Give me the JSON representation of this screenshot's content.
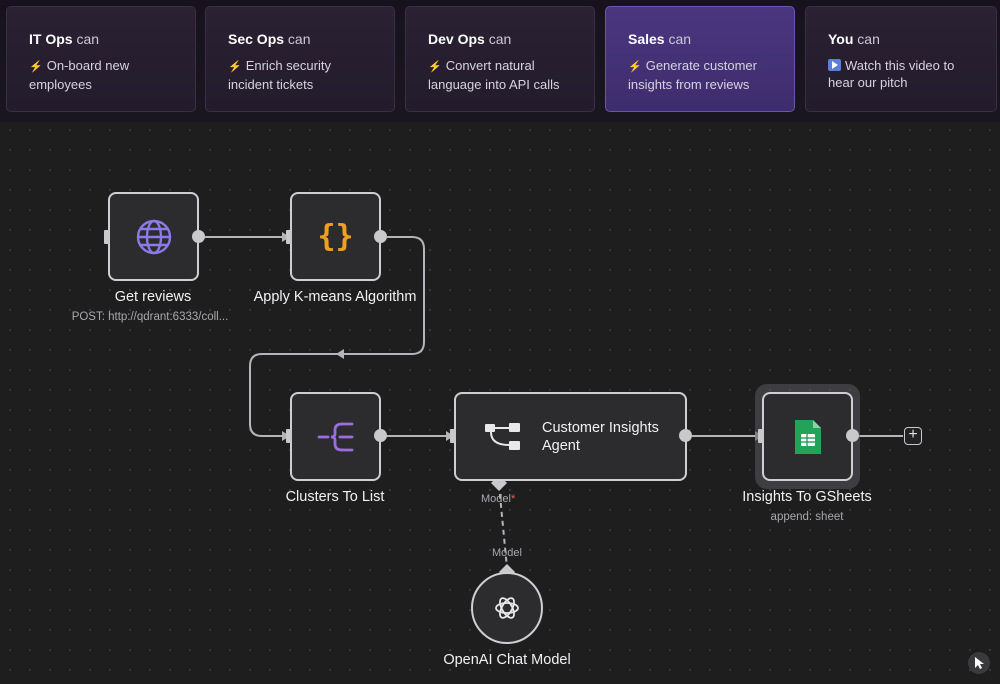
{
  "personas": [
    {
      "team": "IT Ops",
      "can": "can",
      "icon": "bolt-icon",
      "desc": "On-board new employees",
      "active": false
    },
    {
      "team": "Sec Ops",
      "can": "can",
      "icon": "bolt-icon",
      "desc": "Enrich security incident tickets",
      "active": false
    },
    {
      "team": "Dev Ops",
      "can": "can",
      "icon": "bolt-icon",
      "desc": "Convert natural language into API calls",
      "active": false
    },
    {
      "team": "Sales",
      "can": "can",
      "icon": "bolt-icon",
      "desc": "Generate customer insights from reviews",
      "active": true
    },
    {
      "team": "You",
      "can": "can",
      "icon": "play-icon",
      "desc": "Watch this video to hear our pitch",
      "active": false
    }
  ],
  "workflow": {
    "nodes": {
      "get_reviews": {
        "label": "Get reviews",
        "sublabel": "POST: http://qdrant:6333/coll...",
        "icon": "globe-icon"
      },
      "kmeans": {
        "label": "Apply K-means Algorithm",
        "icon": "code-braces-icon"
      },
      "clusters": {
        "label": "Clusters To List",
        "icon": "split-list-icon"
      },
      "agent": {
        "label_line1": "Customer Insights",
        "label_line2": "Agent",
        "icon": "agent-tree-icon",
        "model_port_label": "Model",
        "model_required": "*"
      },
      "gsheets": {
        "label": "Insights To GSheets",
        "sublabel": "append: sheet",
        "icon": "google-sheets-icon"
      },
      "openai": {
        "label": "OpenAI Chat Model",
        "icon": "openai-icon",
        "connection_label": "Model"
      }
    },
    "add_button": "+"
  },
  "colors": {
    "accent_active": "#4a3680",
    "bolt": "#f0c020",
    "globe": "#8b7ae8",
    "braces": "#f0a020",
    "split": "#9b6ee0",
    "sheets": "#22a35a"
  }
}
